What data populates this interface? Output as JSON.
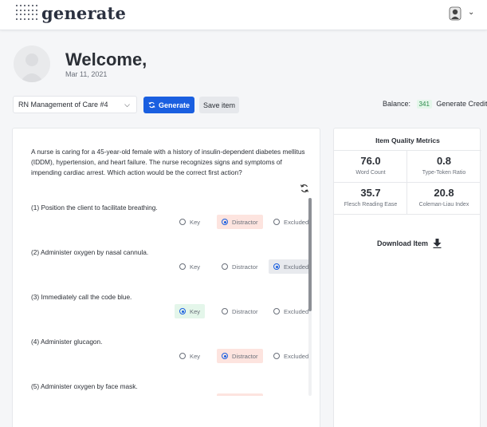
{
  "header": {
    "logo_text": "generate",
    "user_icon": "user-avatar-icon",
    "menu_icon": "chevron-down-icon"
  },
  "welcome": {
    "title": "Welcome,",
    "date": "Mar 11, 2021"
  },
  "toolbar": {
    "selected_item": "RN Management of Care #4",
    "generate_label": "Generate",
    "save_label": "Save item",
    "balance_label": "Balance:",
    "balance_value": "341",
    "balance_unit": "Generate Credits"
  },
  "question": {
    "stem": "A nurse is caring for a 45-year-old female with a history of insulin-dependent diabetes mellitus (IDDM), hypertension, and heart failure. The nurse recognizes signs and symptoms of impending cardiac arrest. Which action would be the correct first action?",
    "radio_labels": {
      "key": "Key",
      "distractor": "Distractor",
      "excluded": "Excluded"
    },
    "options": [
      {
        "text": "(1) Position the client to facilitate breathing.",
        "selected": "distractor"
      },
      {
        "text": "(2) Administer oxygen by nasal cannula.",
        "selected": "excluded"
      },
      {
        "text": "(3) Immediately call the code blue.",
        "selected": "key"
      },
      {
        "text": "(4) Administer glucagon.",
        "selected": "distractor"
      },
      {
        "text": "(5) Administer oxygen by face mask.",
        "selected": "distractor"
      }
    ]
  },
  "metrics": {
    "title": "Item Quality Metrics",
    "items": [
      {
        "value": "76.0",
        "label": "Word Count"
      },
      {
        "value": "0.8",
        "label": "Type-Token Ratio"
      },
      {
        "value": "35.7",
        "label": "Flesch Reading Ease"
      },
      {
        "value": "20.8",
        "label": "Coleman-Liau Index"
      }
    ],
    "download_label": "Download Item"
  },
  "colors": {
    "primary": "#1a5fe0",
    "key_bg": "#e4f6ea",
    "distractor_bg": "#fde4df",
    "excluded_bg": "#e8eaee"
  }
}
